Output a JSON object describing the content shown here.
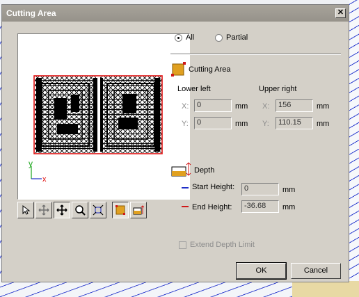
{
  "dialog": {
    "title": "Cutting Area"
  },
  "scope": {
    "all_label": "All",
    "partial_label": "Partial",
    "selected": "All"
  },
  "cutting_area": {
    "heading": "Cutting Area",
    "lower_left_label": "Lower left",
    "upper_right_label": "Upper right",
    "lower_left": {
      "x_label": "X:",
      "x": "0",
      "y_label": "Y:",
      "y": "0"
    },
    "upper_right": {
      "x_label": "X:",
      "x": "156",
      "y_label": "Y:",
      "y": "110.15"
    },
    "unit": "mm"
  },
  "depth": {
    "heading": "Depth",
    "start_label": "Start Height:",
    "start_value": "0",
    "end_label": "End Height:",
    "end_value": "-36.68",
    "unit": "mm",
    "start_color": "#1f2fc8",
    "end_color": "#d01818"
  },
  "extend": {
    "label": "Extend Depth Limit",
    "checked": false,
    "enabled": false
  },
  "buttons": {
    "ok": "OK",
    "cancel": "Cancel"
  },
  "preview": {
    "axis_y": "y",
    "axis_x": "x",
    "boundary_color": "#e01010"
  },
  "tools": [
    {
      "name": "select-icon"
    },
    {
      "name": "pan-icon"
    },
    {
      "name": "move-icon",
      "pressed": true
    },
    {
      "name": "zoom-icon"
    },
    {
      "name": "fit-icon"
    },
    {
      "name": "area-icon",
      "pressed": true
    },
    {
      "name": "depth-icon"
    }
  ]
}
